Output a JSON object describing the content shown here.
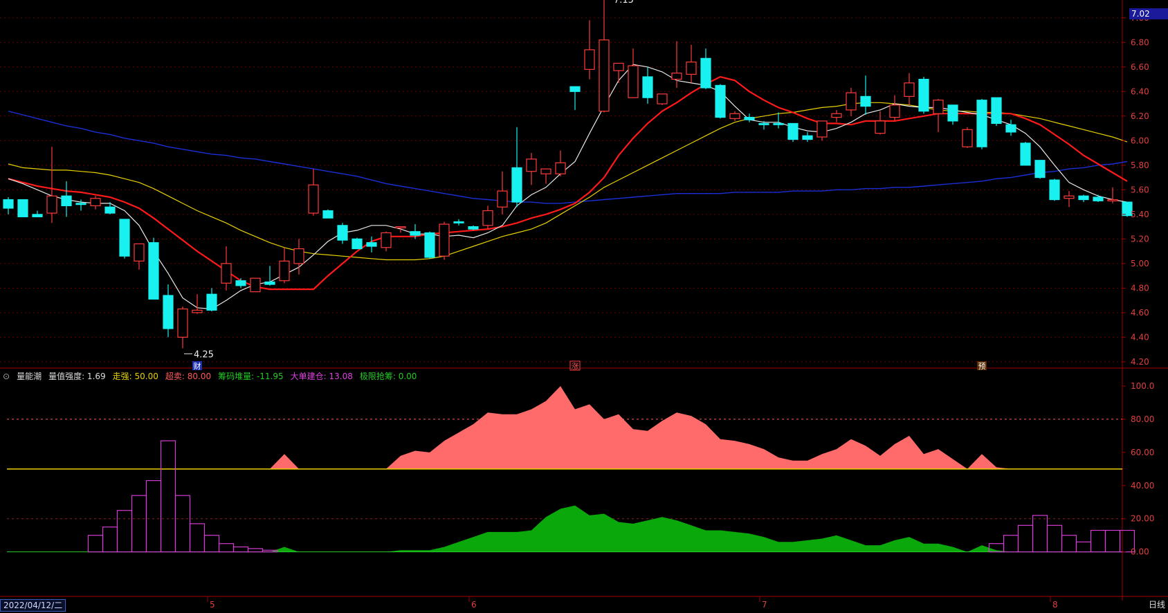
{
  "price_tag": "7.02",
  "indicator": {
    "name": "量能潮",
    "items": [
      {
        "label": "量值强度",
        "value": "1.69",
        "color": "#dddddd"
      },
      {
        "label": "走强",
        "value": "50.00",
        "color": "#e8d100"
      },
      {
        "label": "超卖",
        "value": "80.00",
        "color": "#ff5a5a"
      },
      {
        "label": "筹码堆量",
        "value": "-11.95",
        "color": "#22cc22"
      },
      {
        "label": "大单建仓",
        "value": "13.08",
        "color": "#e040e0"
      },
      {
        "label": "极限抢筹",
        "value": "0.00",
        "color": "#22cc22"
      }
    ]
  },
  "footer": {
    "date": "2022/04/12/二",
    "period": "日线",
    "month_labels": [
      "5",
      "6",
      "7",
      "8"
    ]
  },
  "annotations": {
    "high": "7.15",
    "low": "4.25",
    "markers": [
      "财",
      "涨",
      "预"
    ]
  },
  "colors": {
    "up": "#ff3b3b",
    "down": "#19f0f0",
    "ma5": "#e8e8e8",
    "ma10": "#ff1a1a",
    "ma20": "#e8d100",
    "ma60": "#1a2fd8",
    "pink_area": "#ff6a6a",
    "green_area": "#0aa80a",
    "magenta": "#d23cd2",
    "grid": "#6a0000"
  },
  "chart_data": [
    {
      "type": "candlestick",
      "y_axis_ticks": [
        "7.00",
        "6.80",
        "6.60",
        "6.40",
        "6.20",
        "6.00",
        "5.80",
        "5.60",
        "5.40",
        "5.20",
        "5.00",
        "4.80",
        "4.60",
        "4.40",
        "4.20"
      ],
      "ylim": [
        4.16,
        7.1
      ],
      "candles": [
        [
          5.52,
          5.54,
          5.45,
          5.4
        ],
        [
          5.52,
          5.52,
          5.38,
          5.4
        ],
        [
          5.4,
          5.43,
          5.38,
          5.39
        ],
        [
          5.41,
          5.95,
          5.55,
          5.33
        ],
        [
          5.55,
          5.67,
          5.47,
          5.38
        ],
        [
          5.49,
          5.52,
          5.48,
          5.43
        ],
        [
          5.47,
          5.55,
          5.53,
          5.44
        ],
        [
          5.46,
          5.5,
          5.41,
          5.4
        ],
        [
          5.36,
          5.36,
          5.06,
          5.04
        ],
        [
          5.02,
          5.15,
          5.16,
          4.95
        ],
        [
          5.17,
          5.21,
          4.71,
          4.71
        ],
        [
          4.74,
          4.83,
          4.47,
          4.4
        ],
        [
          4.4,
          4.65,
          4.63,
          4.31
        ],
        [
          4.6,
          4.75,
          4.62,
          4.59
        ],
        [
          4.75,
          4.8,
          4.62,
          4.61
        ],
        [
          4.84,
          5.14,
          5.0,
          4.78
        ],
        [
          4.86,
          4.88,
          4.82,
          4.8
        ],
        [
          4.77,
          4.78,
          4.88,
          4.77
        ],
        [
          4.85,
          4.98,
          4.83,
          4.82
        ],
        [
          4.86,
          5.13,
          5.02,
          4.84
        ],
        [
          5.0,
          5.2,
          5.12,
          4.91
        ],
        [
          5.41,
          5.77,
          5.64,
          5.39
        ],
        [
          5.43,
          5.44,
          5.37,
          5.37
        ],
        [
          5.31,
          5.33,
          5.19,
          5.16
        ],
        [
          5.2,
          5.21,
          5.12,
          5.12
        ],
        [
          5.17,
          5.22,
          5.14,
          5.09
        ],
        [
          5.13,
          5.26,
          5.25,
          5.1
        ],
        [
          5.29,
          5.29,
          5.3,
          5.25
        ],
        [
          5.26,
          5.32,
          5.23,
          5.2
        ],
        [
          5.25,
          5.26,
          5.05,
          5.04
        ],
        [
          5.06,
          5.34,
          5.32,
          5.03
        ],
        [
          5.34,
          5.36,
          5.33,
          5.31
        ],
        [
          5.3,
          5.31,
          5.28,
          5.27
        ],
        [
          5.31,
          5.47,
          5.43,
          5.28
        ],
        [
          5.46,
          5.75,
          5.59,
          5.4
        ],
        [
          5.78,
          6.11,
          5.5,
          5.46
        ],
        [
          5.75,
          5.9,
          5.85,
          5.64
        ],
        [
          5.73,
          5.76,
          5.77,
          5.65
        ],
        [
          5.73,
          5.92,
          5.82,
          5.71
        ],
        [
          6.44,
          6.44,
          6.4,
          6.25
        ],
        [
          6.58,
          6.98,
          6.74,
          6.5
        ],
        [
          6.24,
          7.15,
          6.82,
          6.23
        ],
        [
          6.57,
          6.61,
          6.63,
          6.47
        ],
        [
          6.35,
          6.75,
          6.61,
          6.35
        ],
        [
          6.52,
          6.6,
          6.35,
          6.3
        ],
        [
          6.3,
          6.35,
          6.38,
          6.29
        ],
        [
          6.5,
          6.81,
          6.55,
          6.43
        ],
        [
          6.54,
          6.78,
          6.64,
          6.47
        ],
        [
          6.67,
          6.75,
          6.43,
          6.42
        ],
        [
          6.45,
          6.46,
          6.19,
          6.18
        ],
        [
          6.18,
          6.24,
          6.22,
          6.16
        ],
        [
          6.19,
          6.22,
          6.17,
          6.15
        ],
        [
          6.14,
          6.16,
          6.13,
          6.09
        ],
        [
          6.14,
          6.23,
          6.13,
          6.1
        ],
        [
          6.14,
          6.14,
          6.01,
          5.99
        ],
        [
          6.04,
          6.07,
          6.01,
          5.99
        ],
        [
          6.03,
          6.16,
          6.16,
          6.0
        ],
        [
          6.19,
          6.25,
          6.22,
          6.15
        ],
        [
          6.25,
          6.43,
          6.39,
          6.2
        ],
        [
          6.36,
          6.53,
          6.28,
          6.21
        ],
        [
          6.06,
          6.24,
          6.16,
          6.05
        ],
        [
          6.19,
          6.37,
          6.29,
          6.16
        ],
        [
          6.36,
          6.55,
          6.47,
          6.29
        ],
        [
          6.5,
          6.52,
          6.24,
          6.22
        ],
        [
          6.22,
          6.34,
          6.33,
          6.07
        ],
        [
          6.29,
          6.29,
          6.16,
          6.13
        ],
        [
          5.95,
          6.11,
          6.09,
          5.94
        ],
        [
          6.33,
          6.34,
          5.95,
          5.93
        ],
        [
          6.35,
          6.35,
          6.14,
          6.12
        ],
        [
          6.13,
          6.17,
          6.07,
          6.04
        ],
        [
          5.98,
          5.99,
          5.8,
          5.8
        ],
        [
          5.84,
          5.84,
          5.7,
          5.69
        ],
        [
          5.68,
          5.69,
          5.52,
          5.51
        ],
        [
          5.53,
          5.59,
          5.55,
          5.46
        ],
        [
          5.55,
          5.56,
          5.52,
          5.5
        ],
        [
          5.54,
          5.56,
          5.51,
          5.5
        ],
        [
          5.51,
          5.62,
          5.52,
          5.49
        ],
        [
          5.5,
          5.5,
          5.39,
          5.38
        ]
      ],
      "ma5": [
        5.69,
        5.65,
        5.6,
        5.55,
        5.52,
        5.5,
        5.49,
        5.49,
        5.43,
        5.31,
        5.1,
        4.92,
        4.72,
        4.64,
        4.63,
        4.7,
        4.78,
        4.83,
        4.85,
        4.91,
        4.97,
        5.07,
        5.18,
        5.25,
        5.27,
        5.31,
        5.31,
        5.28,
        5.24,
        5.24,
        5.22,
        5.23,
        5.21,
        5.25,
        5.31,
        5.47,
        5.56,
        5.62,
        5.73,
        5.83,
        6.06,
        6.28,
        6.49,
        6.62,
        6.6,
        6.56,
        6.49,
        6.47,
        6.45,
        6.4,
        6.28,
        6.17,
        6.15,
        6.15,
        6.11,
        6.08,
        6.07,
        6.1,
        6.15,
        6.22,
        6.25,
        6.3,
        6.28,
        6.27,
        6.27,
        6.25,
        6.23,
        6.21,
        6.17,
        6.13,
        6.06,
        5.95,
        5.8,
        5.66,
        5.6,
        5.55,
        5.52,
        5.5
      ],
      "ma10": [
        5.69,
        5.66,
        5.63,
        5.61,
        5.59,
        5.58,
        5.56,
        5.54,
        5.5,
        5.45,
        5.37,
        5.28,
        5.19,
        5.1,
        5.02,
        4.94,
        4.86,
        4.81,
        4.79,
        4.79,
        4.79,
        4.79,
        4.9,
        5.0,
        5.1,
        5.18,
        5.22,
        5.22,
        5.22,
        5.24,
        5.25,
        5.26,
        5.27,
        5.28,
        5.3,
        5.33,
        5.37,
        5.4,
        5.44,
        5.49,
        5.58,
        5.7,
        5.88,
        6.02,
        6.14,
        6.24,
        6.31,
        6.39,
        6.46,
        6.52,
        6.49,
        6.4,
        6.33,
        6.27,
        6.23,
        6.18,
        6.14,
        6.14,
        6.13,
        6.16,
        6.16,
        6.16,
        6.18,
        6.2,
        6.22,
        6.22,
        6.22,
        6.22,
        6.22,
        6.22,
        6.18,
        6.13,
        6.05,
        5.97,
        5.88,
        5.81,
        5.74,
        5.67
      ],
      "ma20": [
        5.81,
        5.78,
        5.77,
        5.76,
        5.76,
        5.75,
        5.74,
        5.72,
        5.69,
        5.66,
        5.61,
        5.55,
        5.49,
        5.43,
        5.38,
        5.33,
        5.27,
        5.22,
        5.17,
        5.13,
        5.1,
        5.08,
        5.07,
        5.06,
        5.05,
        5.04,
        5.03,
        5.03,
        5.03,
        5.04,
        5.06,
        5.1,
        5.14,
        5.18,
        5.22,
        5.25,
        5.28,
        5.33,
        5.4,
        5.47,
        5.54,
        5.62,
        5.68,
        5.74,
        5.8,
        5.86,
        5.92,
        5.98,
        6.04,
        6.1,
        6.15,
        6.18,
        6.2,
        6.22,
        6.23,
        6.25,
        6.27,
        6.28,
        6.3,
        6.31,
        6.31,
        6.3,
        6.29,
        6.27,
        6.25,
        6.24,
        6.24,
        6.23,
        6.23,
        6.22,
        6.2,
        6.18,
        6.15,
        6.12,
        6.09,
        6.06,
        6.03,
        5.99
      ],
      "ma60": [
        6.24,
        6.21,
        6.18,
        6.15,
        6.12,
        6.1,
        6.07,
        6.05,
        6.02,
        6.0,
        5.98,
        5.95,
        5.93,
        5.91,
        5.89,
        5.88,
        5.86,
        5.85,
        5.83,
        5.81,
        5.79,
        5.77,
        5.75,
        5.73,
        5.71,
        5.68,
        5.65,
        5.63,
        5.61,
        5.59,
        5.57,
        5.55,
        5.53,
        5.52,
        5.51,
        5.5,
        5.5,
        5.49,
        5.49,
        5.5,
        5.51,
        5.52,
        5.53,
        5.54,
        5.55,
        5.56,
        5.57,
        5.57,
        5.57,
        5.57,
        5.58,
        5.58,
        5.58,
        5.58,
        5.59,
        5.59,
        5.59,
        5.6,
        5.6,
        5.61,
        5.61,
        5.62,
        5.62,
        5.63,
        5.64,
        5.65,
        5.66,
        5.67,
        5.69,
        5.7,
        5.72,
        5.74,
        5.75,
        5.77,
        5.78,
        5.8,
        5.81,
        5.83
      ]
    },
    {
      "type": "area",
      "title": "量能潮",
      "y_axis_ticks": [
        "100.0",
        "80.00",
        "60.00",
        "40.00",
        "20.00",
        "0.00"
      ],
      "ylim": [
        -26,
        105
      ],
      "pink_base": 50,
      "pink": [
        50,
        50,
        50,
        50,
        50,
        50,
        50,
        50,
        50,
        50,
        50,
        50,
        50,
        50,
        50,
        50,
        50,
        50,
        50,
        59,
        50,
        50,
        50,
        50,
        50,
        50,
        50,
        58,
        61,
        60,
        67,
        72,
        77,
        84,
        83,
        83,
        86,
        91,
        100,
        86,
        89,
        80,
        83,
        74,
        73,
        79,
        84,
        82,
        77,
        68,
        67,
        65,
        62,
        57,
        55,
        55,
        59,
        62,
        68,
        64,
        58,
        65,
        70,
        59,
        62,
        56,
        50,
        59,
        51,
        50,
        50,
        50,
        50,
        50,
        50,
        50,
        50,
        50
      ],
      "green": [
        0,
        0,
        0,
        0,
        0,
        0,
        0,
        0,
        0,
        0,
        0,
        0,
        0,
        0,
        0,
        0,
        0,
        0,
        0,
        3,
        0,
        0,
        0,
        0,
        0,
        0,
        0,
        1,
        1,
        1,
        3,
        6,
        9,
        12,
        12,
        12,
        13,
        21,
        26,
        28,
        22,
        23,
        18,
        17,
        19,
        21,
        19,
        16,
        13,
        13,
        12,
        11,
        9,
        6,
        6,
        7,
        8,
        10,
        7,
        4,
        4,
        7,
        9,
        5,
        5,
        3,
        0,
        4,
        1,
        0,
        0,
        0,
        0,
        0,
        0,
        0,
        0,
        0
      ],
      "magenta": [
        0,
        0,
        0,
        0,
        0,
        0,
        10,
        15,
        25,
        34,
        43,
        67,
        34,
        17,
        10,
        5,
        3,
        2,
        1,
        0,
        0,
        0,
        0,
        0,
        0,
        0,
        0,
        0,
        0,
        0,
        0,
        0,
        0,
        0,
        0,
        0,
        0,
        0,
        0,
        0,
        0,
        0,
        0,
        0,
        0,
        0,
        0,
        0,
        0,
        0,
        0,
        0,
        0,
        0,
        0,
        0,
        0,
        0,
        0,
        0,
        0,
        0,
        0,
        0,
        0,
        0,
        0,
        0,
        5,
        10,
        16,
        22,
        16,
        10,
        6,
        13,
        13,
        13
      ],
      "ref_lines": [
        80,
        50,
        20,
        0
      ]
    }
  ]
}
